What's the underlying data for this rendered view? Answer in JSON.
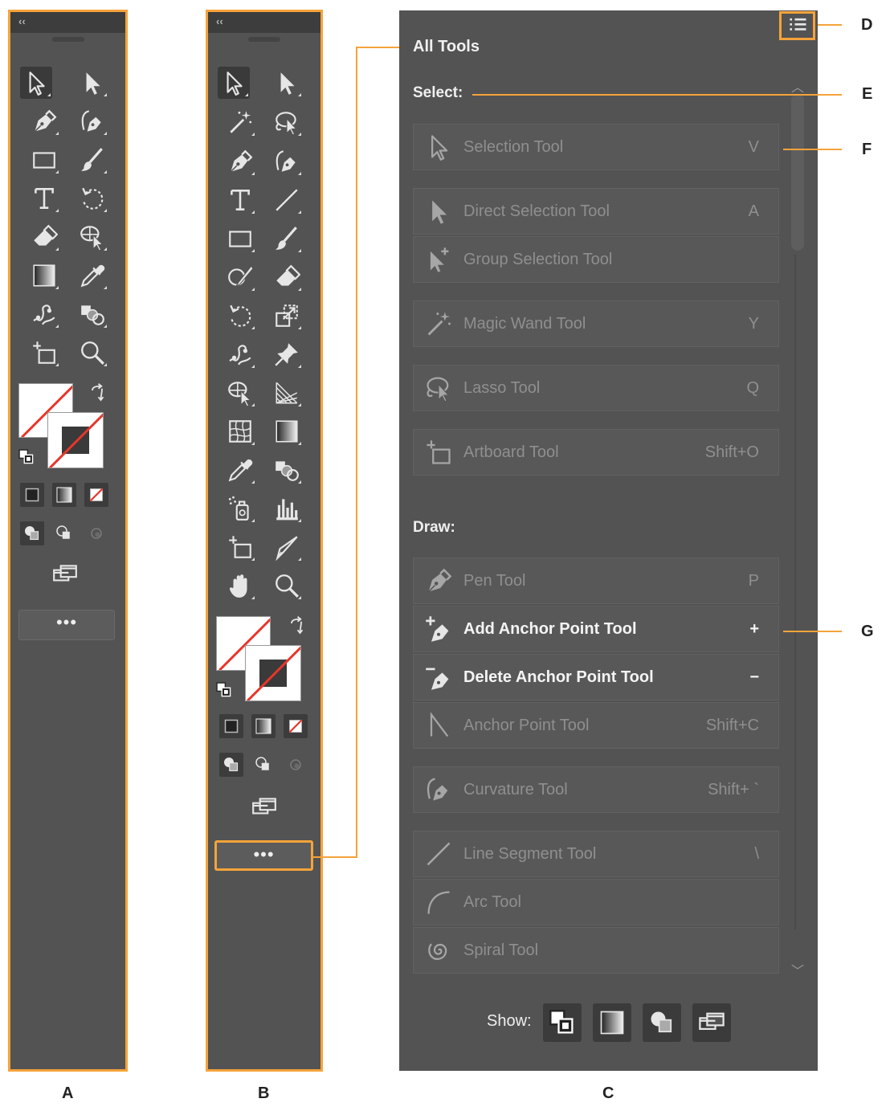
{
  "toolbar_a": {
    "collapse_glyph": "‹‹",
    "more_label": "•••"
  },
  "toolbar_b": {
    "collapse_glyph": "‹‹",
    "more_label": "•••"
  },
  "panel": {
    "title": "All Tools",
    "sections": [
      {
        "heading": "Select:",
        "tools": [
          {
            "name": "Selection Tool",
            "key": "V",
            "icon": "selection-arrow-icon"
          },
          {
            "name": "Direct Selection Tool",
            "key": "A",
            "icon": "direct-selection-arrow-icon"
          },
          {
            "name": "Group Selection Tool",
            "key": "",
            "icon": "group-selection-icon"
          },
          {
            "name": "Magic Wand Tool",
            "key": "Y",
            "icon": "magic-wand-icon"
          },
          {
            "name": "Lasso Tool",
            "key": "Q",
            "icon": "lasso-icon"
          },
          {
            "name": "Artboard Tool",
            "key": "Shift+O",
            "icon": "artboard-icon"
          }
        ]
      },
      {
        "heading": "Draw:",
        "tools": [
          {
            "name": "Pen Tool",
            "key": "P",
            "icon": "pen-icon"
          },
          {
            "name": "Add Anchor Point Tool",
            "key": "+",
            "icon": "add-anchor-point-icon"
          },
          {
            "name": "Delete Anchor Point Tool",
            "key": "−",
            "icon": "delete-anchor-point-icon"
          },
          {
            "name": "Anchor Point Tool",
            "key": "Shift+C",
            "icon": "anchor-point-icon"
          },
          {
            "name": "Curvature Tool",
            "key": "Shift+ `",
            "icon": "curvature-icon"
          },
          {
            "name": "Line Segment Tool",
            "key": "\\",
            "icon": "line-segment-icon"
          },
          {
            "name": "Arc Tool",
            "key": "",
            "icon": "arc-icon"
          },
          {
            "name": "Spiral Tool",
            "key": "",
            "icon": "spiral-icon"
          }
        ]
      }
    ],
    "show_label": "Show:"
  },
  "callouts": {
    "d": "D",
    "e": "E",
    "f": "F",
    "g": "G"
  },
  "captions": {
    "a": "A",
    "b": "B",
    "c": "C"
  },
  "colors": {
    "accent": "#f5a33a",
    "panel_bg": "#535353",
    "stroke_red": "#e8362b"
  }
}
